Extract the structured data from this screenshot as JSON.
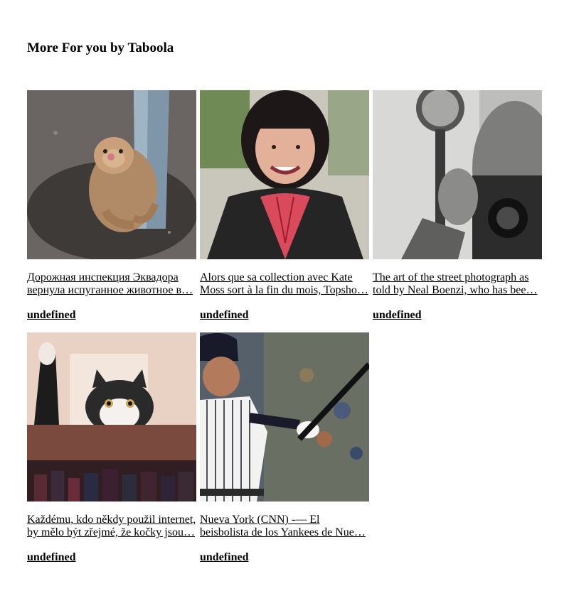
{
  "widget": {
    "heading": "More For you by Taboola"
  },
  "cards": [
    {
      "image": "sloth-hugging-pole-photo",
      "title_line1": "Дорожная инспекция Эквадора",
      "title_line2": "вернула испуганное животное в…",
      "branding": "undefined"
    },
    {
      "image": "smiling-woman-portrait-photo",
      "title_line1": "Alors que sa collection avec Kate",
      "title_line2": "Moss sort à la fin du mois, Topsho…",
      "branding": "undefined"
    },
    {
      "image": "street-photographer-with-camera-photo",
      "title_line1": "The art of the street photograph as",
      "title_line2": "told by Neal Boenzi, who has bee…",
      "branding": "undefined"
    },
    {
      "image": "cat-peeking-over-bookshelf-photo",
      "title_line1": "Každému, kdo někdy použil internet,",
      "title_line2": "by mělo být zřejmé, že kočky jsou…",
      "branding": "undefined"
    },
    {
      "image": "yankees-baseball-player-batting-photo",
      "title_line1": "Nueva York (CNN) -— El",
      "title_line2": "beisbolista de los Yankees de Nue…",
      "branding": "undefined"
    }
  ]
}
